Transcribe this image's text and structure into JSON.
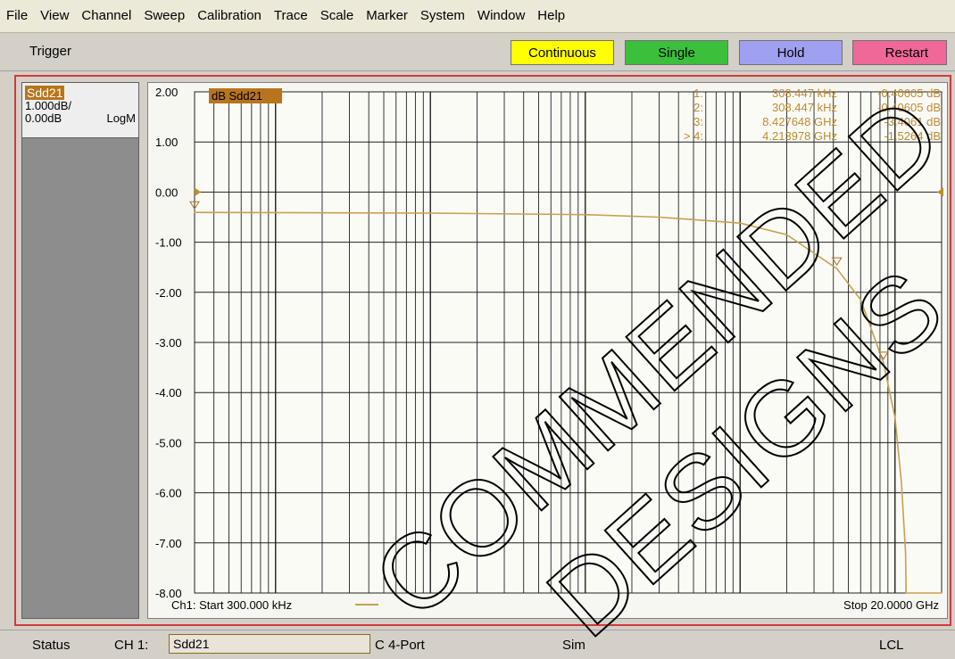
{
  "menu": [
    "File",
    "View",
    "Channel",
    "Sweep",
    "Calibration",
    "Trace",
    "Scale",
    "Marker",
    "System",
    "Window",
    "Help"
  ],
  "toolbar": {
    "trigger_label": "Trigger",
    "continuous": "Continuous",
    "single": "Single",
    "hold": "Hold",
    "restart": "Restart",
    "colors": {
      "continuous": "#ffff00",
      "single": "#3cbf3c",
      "hold": "#a0a0f0",
      "restart": "#f06898"
    }
  },
  "side_panel": {
    "trace_name": "Sdd21",
    "scale": "1.000dB/",
    "reference": "0.00dB",
    "format": "LogM"
  },
  "plot": {
    "trace_label": "dB Sdd21",
    "start_label": "Ch1: Start  300.000 kHz",
    "stop_label": "Stop  20.0000 GHz",
    "y_ticks": [
      "2.00",
      "1.00",
      "0.00",
      "-1.00",
      "-2.00",
      "-3.00",
      "-4.00",
      "-5.00",
      "-6.00",
      "-7.00",
      "-8.00"
    ],
    "markers": [
      {
        "id": "1:",
        "freq": "308.447 kHz",
        "value": "-0.40605 dB"
      },
      {
        "id": "2:",
        "freq": "308.447 kHz",
        "value": "-0.40605 dB"
      },
      {
        "id": "3:",
        "freq": "8.427648 GHz",
        "value": "-3.4061 dB"
      },
      {
        "id": "> 4:",
        "freq": "4.213978 GHz",
        "value": "-1.5264 dB"
      }
    ],
    "trace_color": "#c8a050"
  },
  "chart_data": {
    "type": "line",
    "x_scale": "log",
    "x_unit": "Hz",
    "xlim": [
      300000,
      20000000000
    ],
    "ylim": [
      -8,
      2
    ],
    "y_step": 1,
    "series": [
      {
        "name": "Sdd21",
        "x": [
          300000,
          1000000,
          10000000,
          100000000,
          300000000,
          1000000000,
          2000000000,
          4213978000,
          6000000000,
          8427648000,
          10000000000,
          11000000000,
          11700000000,
          11800000000,
          20000000000
        ],
        "y": [
          -0.406,
          -0.41,
          -0.42,
          -0.45,
          -0.5,
          -0.62,
          -0.85,
          -1.5264,
          -2.15,
          -3.4061,
          -4.5,
          -5.8,
          -7.2,
          -8.0,
          -8.0
        ]
      }
    ]
  },
  "status": {
    "label": "Status",
    "channel": "CH 1:",
    "trace": "Sdd21",
    "port": "C  4-Port",
    "mode": "Sim",
    "remote": "LCL"
  },
  "watermark": {
    "line1": "COMMENDED",
    "line2": "DESIGNS"
  }
}
